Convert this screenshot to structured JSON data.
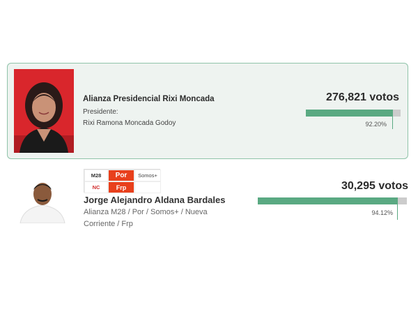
{
  "candidates": [
    {
      "party": "Alianza Presidencial Rixi Moncada",
      "role": "Presidente:",
      "name": "Rixi Ramona Moncada Godoy",
      "votes": "276,821 votos",
      "percent_label": "92.20%",
      "bar_fraction": 0.92,
      "photo_background": "#d9262c"
    },
    {
      "name": "Jorge Alejandro Aldana Bardales",
      "party_line1": "Alianza M28 / Por / Somos+ / Nueva",
      "party_line2": "Corriente / Frp",
      "votes": "30,295 votos",
      "percent_label": "94.12%",
      "bar_fraction": 0.94,
      "logos": [
        "M28",
        "Por",
        "Somos+",
        "NC",
        "Frp"
      ]
    }
  ],
  "colors": {
    "bar_fill": "#5aa982",
    "bar_track": "#cccccc",
    "card_border": "#8fc3a9",
    "card_background": "#eef3f0",
    "logo_orange": "#e8401c"
  }
}
